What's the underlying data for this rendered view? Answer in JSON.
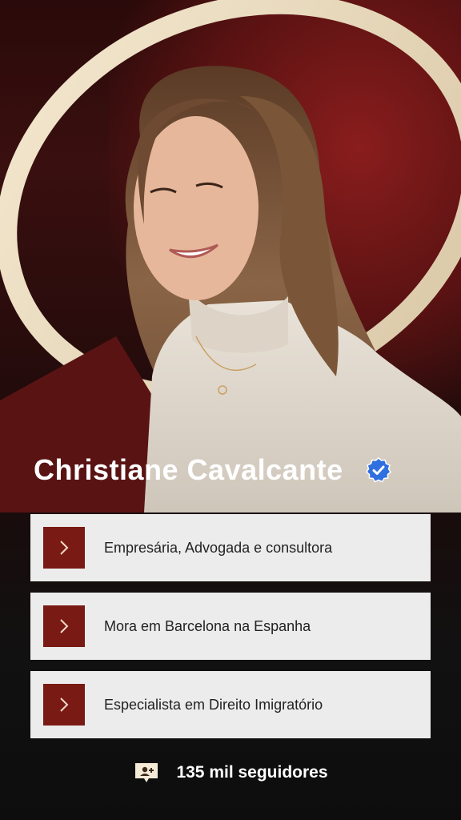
{
  "profile": {
    "name": "Christiane Cavalcante",
    "verified": true
  },
  "cards": [
    {
      "text": "Empresária, Advogada e consultora",
      "icon": "chevron-right-icon"
    },
    {
      "text": "Mora em Barcelona na Espanha",
      "icon": "chevron-right-icon"
    },
    {
      "text": "Especialista em Direito Imigratório",
      "icon": "chevron-right-icon"
    }
  ],
  "footer": {
    "followers": "135 mil seguidores",
    "icon": "followers-icon"
  },
  "colors": {
    "accent": "#7a1a14",
    "card_bg": "#ececec",
    "verified_blue": "#2f6fe0",
    "ring_cream": "#efe2c8"
  }
}
